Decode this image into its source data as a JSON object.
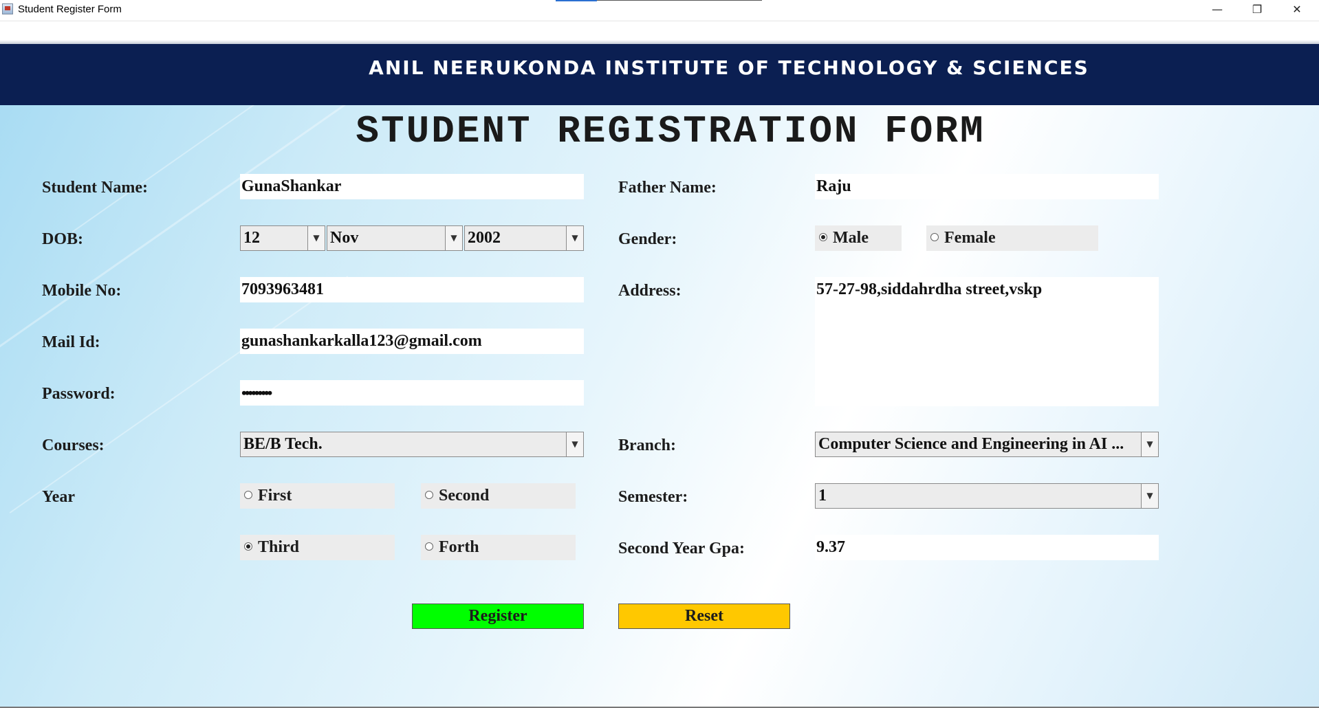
{
  "window": {
    "title": "Student Register Form",
    "controls": {
      "minimize": "—",
      "restore": "❐",
      "close": "✕"
    }
  },
  "banner": {
    "institute_name": "ANIL NEERUKONDA INSTITUTE OF TECHNOLOGY & SCIENCES"
  },
  "form": {
    "title": "STUDENT REGISTRATION FORM",
    "student_name": {
      "label": "Student Name:",
      "value": "GunaShankar"
    },
    "father_name": {
      "label": "Father Name:",
      "value": "Raju"
    },
    "dob": {
      "label": "DOB:",
      "day": "12",
      "month": "Nov",
      "year": "2002"
    },
    "gender": {
      "label": "Gender:",
      "male": "Male",
      "female": "Female",
      "selected": "Male"
    },
    "mobile": {
      "label": "Mobile No:",
      "value": "7093963481"
    },
    "address": {
      "label": "Address:",
      "value": "57-27-98,siddahrdha street,vskp"
    },
    "mail": {
      "label": "Mail Id:",
      "value": "gunashankarkalla123@gmail.com"
    },
    "password": {
      "label": "Password:",
      "value": "•••••••••"
    },
    "courses": {
      "label": "Courses:",
      "value": "BE/B Tech."
    },
    "branch": {
      "label": "Branch:",
      "value": "Computer Science and Engineering in AI ..."
    },
    "year": {
      "label": "Year",
      "first": "First",
      "second": "Second",
      "third": "Third",
      "forth": "Forth",
      "selected": "Third"
    },
    "semester": {
      "label": "Semester:",
      "value": "1"
    },
    "gpa": {
      "label": "Second Year Gpa:",
      "value": "9.37"
    },
    "buttons": {
      "register": "Register",
      "reset": "Reset"
    },
    "colors": {
      "register": "#00ff00",
      "reset": "#ffc800",
      "banner": "#0b1f52"
    }
  }
}
